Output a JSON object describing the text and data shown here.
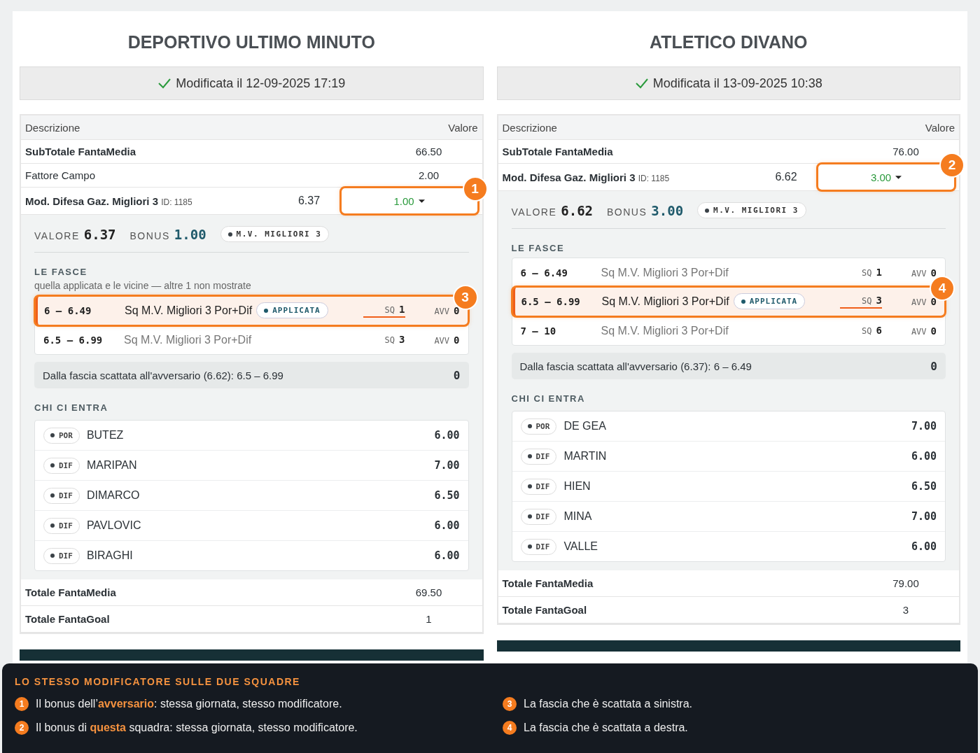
{
  "teams": [
    {
      "name": "DEPORTIVO ULTIMO MINUTO",
      "modified": "Modificata il 12-09-2025 17:19",
      "columns": [
        "Descrizione",
        "Valore"
      ],
      "rows": [
        {
          "label": "SubTotale FantaMedia",
          "value": "66.50",
          "bold": true
        },
        {
          "label": "Fattore Campo",
          "value": "2.00",
          "bold": false
        }
      ],
      "modifier": {
        "label": "Mod. Difesa Gaz. Migliori 3",
        "id": "ID: 1185",
        "reading": "6.37",
        "value": "1.00",
        "callout": "1"
      },
      "detail": {
        "valore_label": "VALORE",
        "valore": "6.37",
        "bonus_label": "BONUS",
        "bonus": "1.00",
        "tag": "M.V. MIGLIORI 3",
        "bands_title": "LE FASCE",
        "bands_note": "quella applicata e le vicine — altre 1 non mostrate",
        "bands": [
          {
            "range": "6 – 6.49",
            "name": "Sq M.V. Migliori 3 Por+Dif",
            "applied": true,
            "badge": "APPLICATA",
            "sq_label": "SQ",
            "sq": "1",
            "avv_label": "AVV",
            "avv": "0",
            "callout": "3"
          },
          {
            "range": "6.5 – 6.99",
            "name": "Sq M.V. Migliori 3 Por+Dif",
            "applied": false,
            "sq_label": "SQ",
            "sq": "3",
            "avv_label": "AVV",
            "avv": "0"
          }
        ],
        "opponent": {
          "text": "Dalla fascia scattata all'avversario (6.62): 6.5 – 6.99",
          "value": "0"
        },
        "players_title": "CHI CI ENTRA",
        "players": [
          {
            "role": "POR",
            "name": "BUTEZ",
            "score": "6.00"
          },
          {
            "role": "DIF",
            "name": "MARIPAN",
            "score": "7.00"
          },
          {
            "role": "DIF",
            "name": "DIMARCO",
            "score": "6.50"
          },
          {
            "role": "DIF",
            "name": "PAVLOVIC",
            "score": "6.00"
          },
          {
            "role": "DIF",
            "name": "BIRAGHI",
            "score": "6.00"
          }
        ]
      },
      "totals": [
        {
          "label": "Totale FantaMedia",
          "value": "69.50"
        },
        {
          "label": "Totale FantaGoal",
          "value": "1"
        }
      ]
    },
    {
      "name": "ATLETICO DIVANO",
      "modified": "Modificata il 13-09-2025 10:38",
      "columns": [
        "Descrizione",
        "Valore"
      ],
      "rows": [
        {
          "label": "SubTotale FantaMedia",
          "value": "76.00",
          "bold": true
        }
      ],
      "modifier": {
        "label": "Mod. Difesa Gaz. Migliori 3",
        "id": "ID: 1185",
        "reading": "6.62",
        "value": "3.00",
        "callout": "2"
      },
      "detail": {
        "valore_label": "VALORE",
        "valore": "6.62",
        "bonus_label": "BONUS",
        "bonus": "3.00",
        "tag": "M.V. MIGLIORI 3",
        "bands_title": "LE FASCE",
        "bands": [
          {
            "range": "6 – 6.49",
            "name": "Sq M.V. Migliori 3 Por+Dif",
            "applied": false,
            "sq_label": "SQ",
            "sq": "1",
            "avv_label": "AVV",
            "avv": "0"
          },
          {
            "range": "6.5 – 6.99",
            "name": "Sq M.V. Migliori 3 Por+Dif",
            "applied": true,
            "badge": "APPLICATA",
            "sq_label": "SQ",
            "sq": "3",
            "avv_label": "AVV",
            "avv": "0",
            "callout": "4"
          },
          {
            "range": "7 – 10",
            "name": "Sq M.V. Migliori 3 Por+Dif",
            "applied": false,
            "sq_label": "SQ",
            "sq": "6",
            "avv_label": "AVV",
            "avv": "0"
          }
        ],
        "opponent": {
          "text": "Dalla fascia scattata all'avversario (6.37): 6 – 6.49",
          "value": "0"
        },
        "players_title": "CHI CI ENTRA",
        "players": [
          {
            "role": "POR",
            "name": "DE GEA",
            "score": "7.00"
          },
          {
            "role": "DIF",
            "name": "MARTIN",
            "score": "6.00"
          },
          {
            "role": "DIF",
            "name": "HIEN",
            "score": "6.50"
          },
          {
            "role": "DIF",
            "name": "MINA",
            "score": "7.00"
          },
          {
            "role": "DIF",
            "name": "VALLE",
            "score": "6.00"
          }
        ]
      },
      "totals": [
        {
          "label": "Totale FantaMedia",
          "value": "79.00"
        },
        {
          "label": "Totale FantaGoal",
          "value": "3"
        }
      ]
    }
  ],
  "legend": {
    "title": "LO STESSO MODIFICATORE SULLE DUE SQUADRE",
    "items": [
      {
        "number": "1",
        "text": "Il bonus dell’**avversario**: stessa giornata, stesso modificatore."
      },
      {
        "number": "3",
        "text": "La fascia che è scattata a sinistra."
      },
      {
        "number": "2",
        "text": "Il bonus di **questa** squadra: stessa giornata, stesso modificatore."
      },
      {
        "number": "4",
        "text": "La fascia che è scattata a destra."
      }
    ]
  }
}
